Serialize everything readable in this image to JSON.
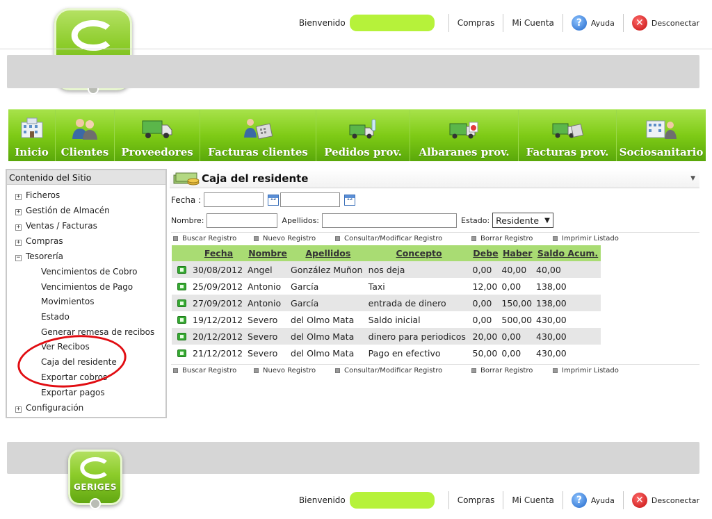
{
  "brand": {
    "logo_text": "GERIGES"
  },
  "header": {
    "welcome_label": "Bienvenido",
    "links": {
      "compras": "Compras",
      "mi_cuenta": "Mi Cuenta",
      "ayuda": "Ayuda",
      "desconectar": "Desconectar"
    },
    "icons": {
      "help": "help-icon",
      "logout": "logout-icon"
    }
  },
  "nav": {
    "items": [
      {
        "label": "Inicio",
        "icon": "building-icon"
      },
      {
        "label": "Clientes",
        "icon": "people-icon"
      },
      {
        "label": "Proveedores",
        "icon": "truck-icon"
      },
      {
        "label": "Facturas clientes",
        "icon": "calculator-people-icon"
      },
      {
        "label": "Pedidos prov.",
        "icon": "truck-bottles-icon"
      },
      {
        "label": "Albaranes prov.",
        "icon": "truck-chart-icon"
      },
      {
        "label": "Facturas prov.",
        "icon": "truck-calculator-icon"
      },
      {
        "label": "Sociosanitario",
        "icon": "hospital-people-icon"
      }
    ],
    "color": "#7fcb16"
  },
  "sidebar": {
    "title": "Contenido del Sitio",
    "items": [
      {
        "label": "Ficheros",
        "toggle": "+"
      },
      {
        "label": "Gestión de Almacén",
        "toggle": "+"
      },
      {
        "label": "Ventas / Facturas",
        "toggle": "+"
      },
      {
        "label": "Compras",
        "toggle": "+"
      },
      {
        "label": "Tesorería",
        "toggle": "−"
      },
      {
        "label": "Vencimientos de Cobro"
      },
      {
        "label": "Vencimientos de Pago"
      },
      {
        "label": "Movimientos"
      },
      {
        "label": "Estado"
      },
      {
        "label": "Generar remesa de recibos"
      },
      {
        "label": "Ver Recibos"
      },
      {
        "label": "Caja del residente"
      },
      {
        "label": "Exportar cobros"
      },
      {
        "label": "Exportar pagos"
      },
      {
        "label": "Configuración",
        "toggle": "+"
      }
    ],
    "highlight_color": "#e10d12"
  },
  "panel": {
    "title": "Caja del residente",
    "icon": "money-icon"
  },
  "filters": {
    "fecha_label": "Fecha :",
    "fecha_desde_value": "",
    "fecha_hasta_value": "",
    "calendar_icon_text": "12",
    "nombre_label": "Nombre:",
    "nombre_value": "",
    "apellidos_label": "Apellidos:",
    "apellidos_value": "",
    "estado_label": "Estado:",
    "estado_selected": "Residente"
  },
  "actions": {
    "buscar": "Buscar Registro",
    "nuevo": "Nuevo Registro",
    "consultar": "Consultar/Modificar Registro",
    "borrar": "Borrar Registro",
    "imprimir": "Imprimir Listado"
  },
  "table": {
    "columns": [
      "Fecha",
      "Nombre",
      "Apellidos",
      "Concepto",
      "Debe",
      "Haber",
      "Saldo Acum."
    ],
    "rows": [
      [
        "30/08/2012",
        "Angel",
        "González Muñon",
        "nos deja",
        "0,00",
        "40,00",
        "40,00"
      ],
      [
        "25/09/2012",
        "Antonio",
        "García",
        "Taxi",
        "12,00",
        "0,00",
        "138,00"
      ],
      [
        "27/09/2012",
        "Antonio",
        "García",
        "entrada de dinero",
        "0,00",
        "150,00",
        "138,00"
      ],
      [
        "19/12/2012",
        "Severo",
        "del Olmo Mata",
        "Saldo inicial",
        "0,00",
        "500,00",
        "430,00"
      ],
      [
        "20/12/2012",
        "Severo",
        "del Olmo Mata",
        "dinero para periodicos",
        "20,00",
        "0,00",
        "430,00"
      ],
      [
        "21/12/2012",
        "Severo",
        "del Olmo Mata",
        "Pago en efectivo",
        "50,00",
        "0,00",
        "430,00"
      ]
    ],
    "header_color": "#a9dc73",
    "alt_row_color": "#e6e6e6"
  }
}
